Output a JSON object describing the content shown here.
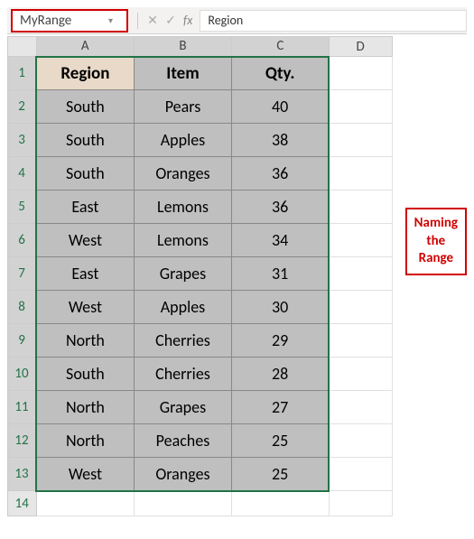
{
  "name_box": "MyRange",
  "fx_label": "fx",
  "formula_value": "Region",
  "columns": [
    "A",
    "B",
    "C",
    "D"
  ],
  "headers": {
    "region": "Region",
    "item": "Item",
    "qty": "Qty."
  },
  "rows": [
    {
      "n": 1
    },
    {
      "n": 2,
      "region": "South",
      "item": "Pears",
      "qty": 40
    },
    {
      "n": 3,
      "region": "South",
      "item": "Apples",
      "qty": 38
    },
    {
      "n": 4,
      "region": "South",
      "item": "Oranges",
      "qty": 36
    },
    {
      "n": 5,
      "region": "East",
      "item": "Lemons",
      "qty": 36
    },
    {
      "n": 6,
      "region": "West",
      "item": "Lemons",
      "qty": 34
    },
    {
      "n": 7,
      "region": "East",
      "item": "Grapes",
      "qty": 31
    },
    {
      "n": 8,
      "region": "West",
      "item": "Apples",
      "qty": 30
    },
    {
      "n": 9,
      "region": "North",
      "item": "Cherries",
      "qty": 29
    },
    {
      "n": 10,
      "region": "South",
      "item": "Cherries",
      "qty": 28
    },
    {
      "n": 11,
      "region": "North",
      "item": "Grapes",
      "qty": 27
    },
    {
      "n": 12,
      "region": "North",
      "item": "Peaches",
      "qty": 25
    },
    {
      "n": 13,
      "region": "West",
      "item": "Oranges",
      "qty": 25
    },
    {
      "n": 14
    }
  ],
  "callout": {
    "l1": "Naming",
    "l2": "the",
    "l3": "Range"
  },
  "chart_data": {
    "type": "table",
    "title": "MyRange",
    "columns": [
      "Region",
      "Item",
      "Qty."
    ],
    "data": [
      [
        "South",
        "Pears",
        40
      ],
      [
        "South",
        "Apples",
        38
      ],
      [
        "South",
        "Oranges",
        36
      ],
      [
        "East",
        "Lemons",
        36
      ],
      [
        "West",
        "Lemons",
        34
      ],
      [
        "East",
        "Grapes",
        31
      ],
      [
        "West",
        "Apples",
        30
      ],
      [
        "North",
        "Cherries",
        29
      ],
      [
        "South",
        "Cherries",
        28
      ],
      [
        "North",
        "Grapes",
        27
      ],
      [
        "North",
        "Peaches",
        25
      ],
      [
        "West",
        "Oranges",
        25
      ]
    ]
  }
}
